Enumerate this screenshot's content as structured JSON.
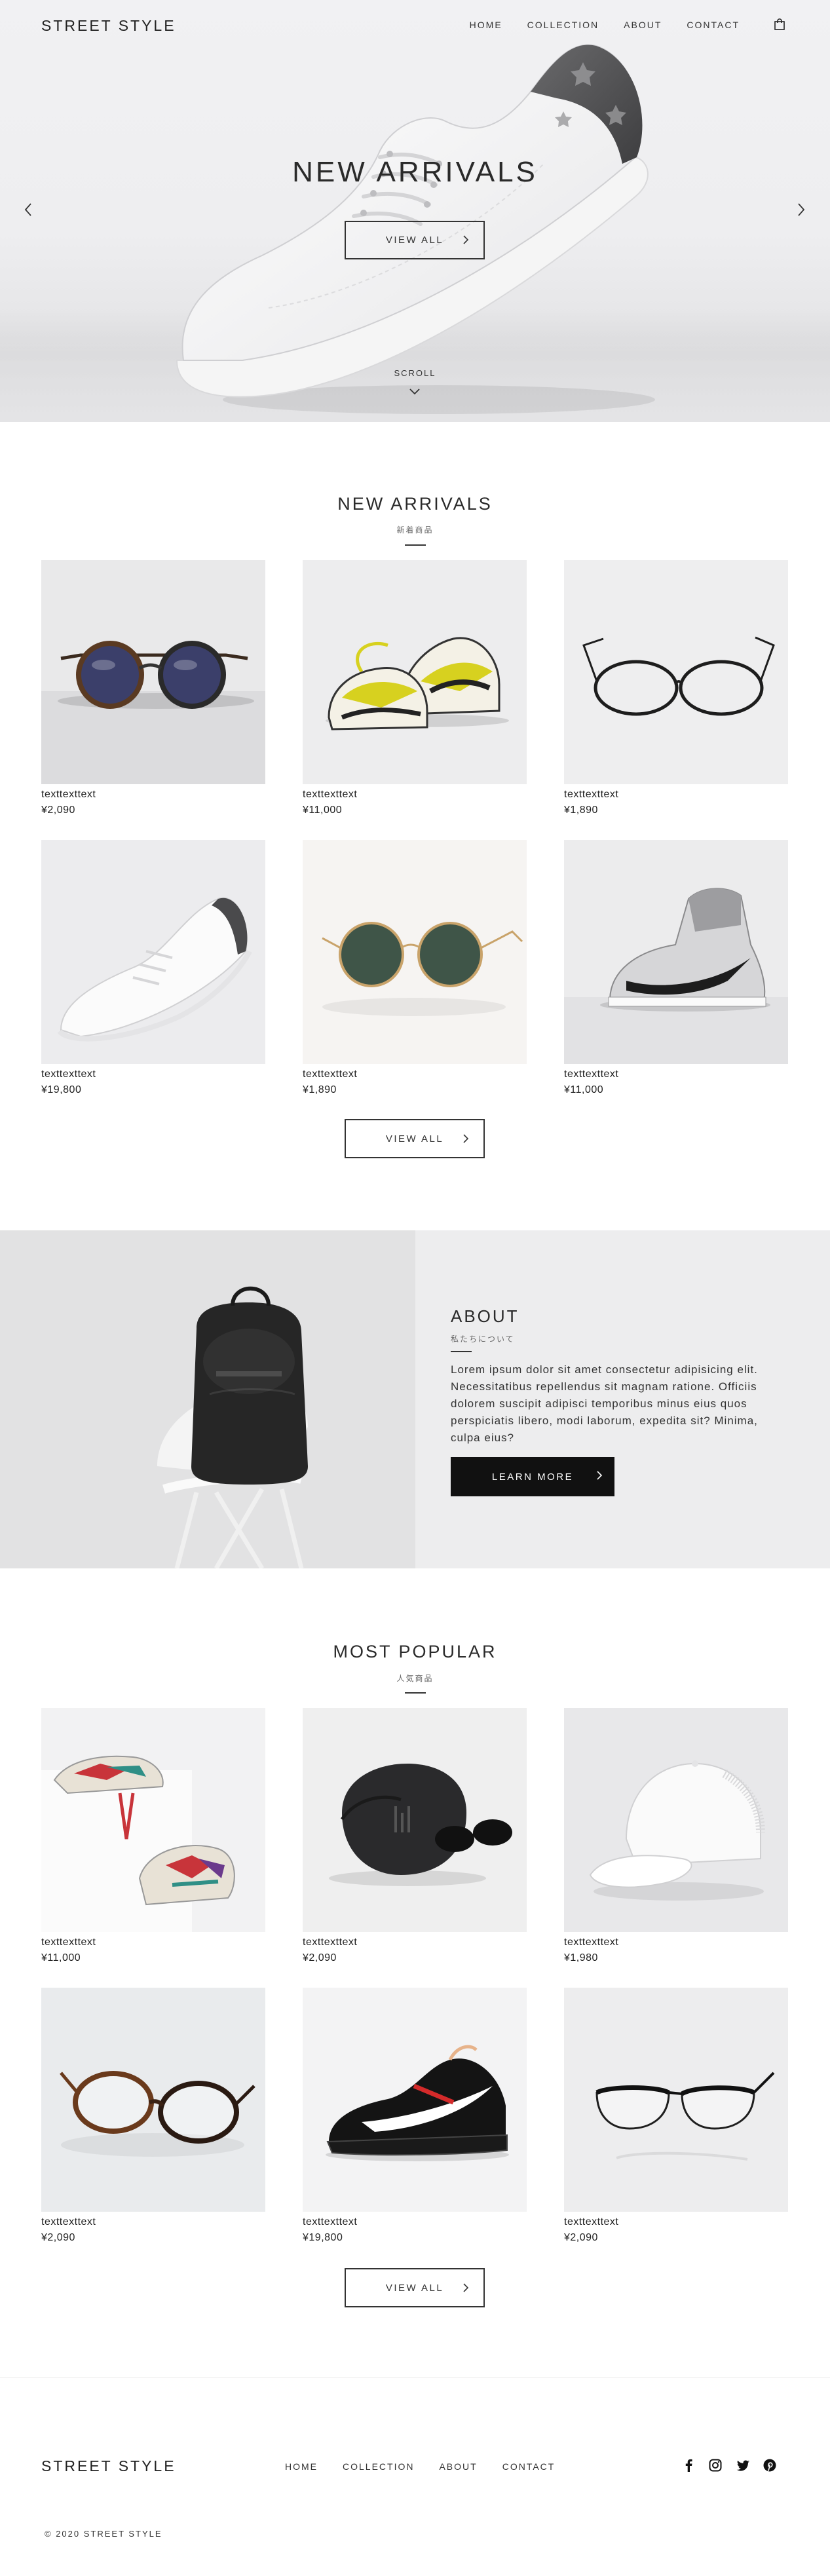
{
  "brand": "STREET STYLE",
  "nav": {
    "items": [
      "HOME",
      "COLLECTION",
      "ABOUT",
      "CONTACT"
    ],
    "cart_icon": "shopping-bag-icon"
  },
  "hero": {
    "title": "NEW ARRIVALS",
    "button_label": "VIEW ALL",
    "scroll_label": "SCROLL",
    "prev_icon": "chevron-left-icon",
    "next_icon": "chevron-right-icon"
  },
  "new_arrivals": {
    "title": "NEW ARRIVALS",
    "subtitle": "新着商品",
    "view_all": "VIEW ALL",
    "items": [
      {
        "name": "texttexttext",
        "price": "¥2,090"
      },
      {
        "name": "texttexttext",
        "price": "¥11,000"
      },
      {
        "name": "texttexttext",
        "price": "¥1,890"
      },
      {
        "name": "texttexttext",
        "price": "¥19,800"
      },
      {
        "name": "texttexttext",
        "price": "¥1,890"
      },
      {
        "name": "texttexttext",
        "price": "¥11,000"
      }
    ]
  },
  "about": {
    "title": "ABOUT",
    "subtitle": "私たちについて",
    "body": "Lorem ipsum dolor sit amet consectetur adipisicing elit. Necessitatibus repellendus sit magnam ratione. Officiis dolorem suscipit adipisci temporibus minus eius quos perspiciatis libero, modi laborum, expedita sit? Minima, culpa eius?",
    "button_label": "LEARN MORE"
  },
  "most_popular": {
    "title": "MOST POPULAR",
    "subtitle": "人気商品",
    "view_all": "VIEW ALL",
    "items": [
      {
        "name": "texttexttext",
        "price": "¥11,000"
      },
      {
        "name": "texttexttext",
        "price": "¥2,090"
      },
      {
        "name": "texttexttext",
        "price": "¥1,980"
      },
      {
        "name": "texttexttext",
        "price": "¥2,090"
      },
      {
        "name": "texttexttext",
        "price": "¥19,800"
      },
      {
        "name": "texttexttext",
        "price": "¥2,090"
      }
    ]
  },
  "footer": {
    "logo": "STREET STYLE",
    "links": [
      "HOME",
      "COLLECTION",
      "ABOUT",
      "CONTACT"
    ],
    "social": [
      "facebook-icon",
      "instagram-icon",
      "twitter-icon",
      "pinterest-icon"
    ],
    "copyright": "© 2020 STREET STYLE"
  }
}
